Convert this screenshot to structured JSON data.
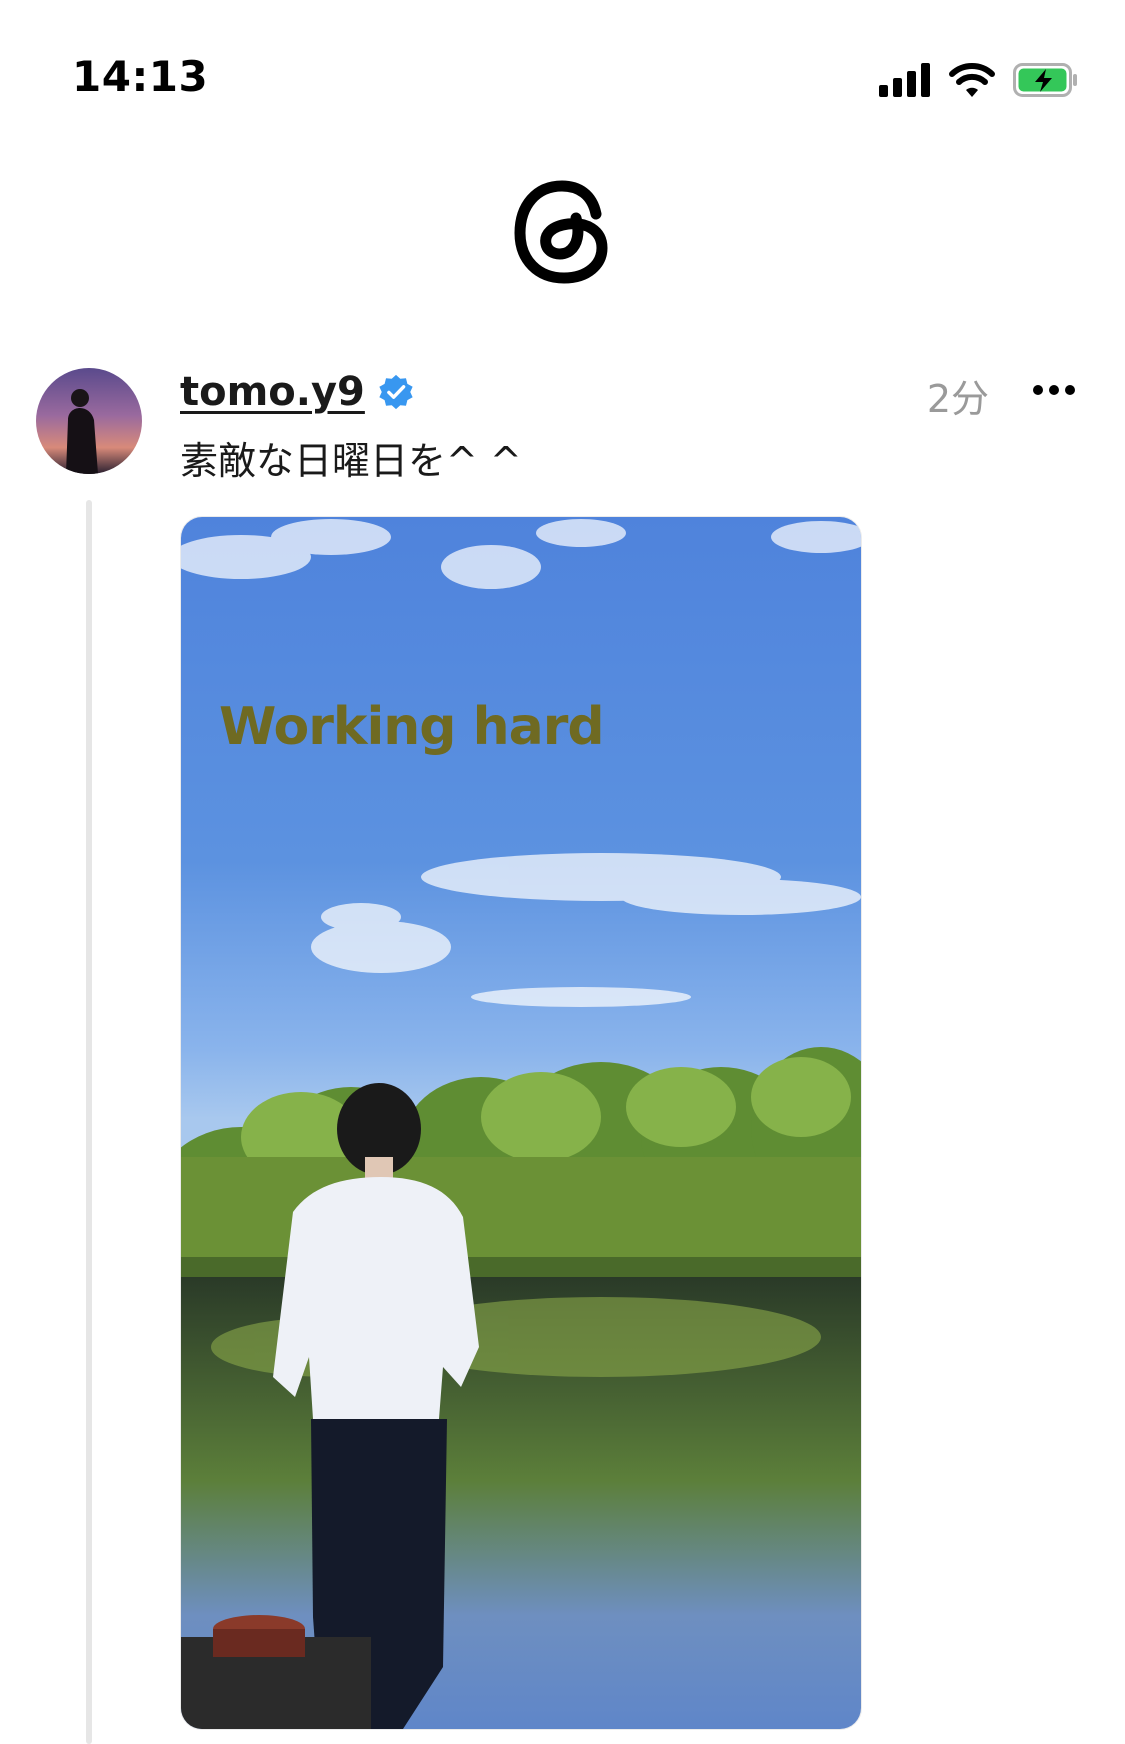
{
  "status_bar": {
    "time": "14:13",
    "icons": [
      "cellular-signal-icon",
      "wifi-icon",
      "battery-charging-icon"
    ],
    "battery_color": "#34c759"
  },
  "header": {
    "logo": "threads-logo-icon"
  },
  "post": {
    "username": "tomo.y9",
    "verified": true,
    "verified_color": "#3897f0",
    "timestamp": "2分",
    "text": "素敵な日曜日を^ ^",
    "more_icon": "more-horizontal-icon",
    "media": {
      "overlay_text": "Working hard"
    }
  }
}
